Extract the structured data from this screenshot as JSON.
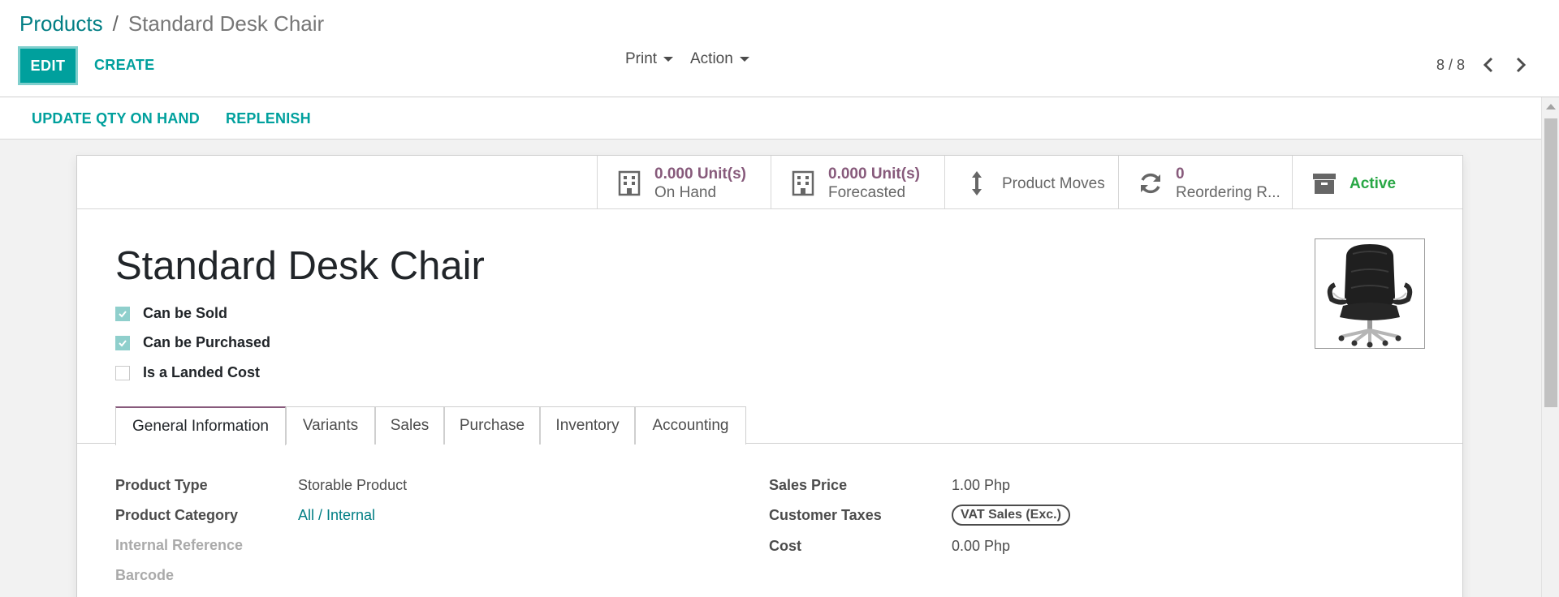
{
  "breadcrumb": {
    "parent": "Products",
    "separator": "/",
    "current": "Standard Desk Chair"
  },
  "toolbar": {
    "edit_label": "EDIT",
    "create_label": "CREATE",
    "print_label": "Print",
    "action_label": "Action"
  },
  "pager": {
    "value": "8 / 8"
  },
  "status_bar": {
    "update_qty_label": "UPDATE QTY ON HAND",
    "replenish_label": "REPLENISH"
  },
  "stats": {
    "on_hand": {
      "value": "0.000 Unit(s)",
      "label": "On Hand",
      "icon": "building-icon"
    },
    "forecasted": {
      "value": "0.000 Unit(s)",
      "label": "Forecasted",
      "icon": "building-icon"
    },
    "moves": {
      "label": "Product Moves",
      "icon": "arrows-v-icon"
    },
    "reordering": {
      "value": "0",
      "label": "Reordering R...",
      "icon": "refresh-icon"
    },
    "active": {
      "label": "Active",
      "icon": "archive-icon",
      "color": "#28a745"
    }
  },
  "product": {
    "name": "Standard Desk Chair",
    "checkboxes": [
      {
        "label": "Can be Sold",
        "checked": true
      },
      {
        "label": "Can be Purchased",
        "checked": true
      },
      {
        "label": "Is a Landed Cost",
        "checked": false
      }
    ]
  },
  "tabs": [
    "General Information",
    "Variants",
    "Sales",
    "Purchase",
    "Inventory",
    "Accounting"
  ],
  "general": {
    "product_type_label": "Product Type",
    "product_type_value": "Storable Product",
    "product_category_label": "Product Category",
    "product_category_value": "All / Internal",
    "internal_reference_label": "Internal Reference",
    "barcode_label": "Barcode",
    "sales_price_label": "Sales Price",
    "sales_price_value": "1.00 Php",
    "customer_taxes_label": "Customer Taxes",
    "customer_taxes_value": "VAT Sales (Exc.)",
    "cost_label": "Cost",
    "cost_value": "0.00 Php"
  },
  "colors": {
    "accent": "#00a09d",
    "link": "#017e84",
    "stat_value": "#875a7b",
    "active_green": "#28a745"
  }
}
